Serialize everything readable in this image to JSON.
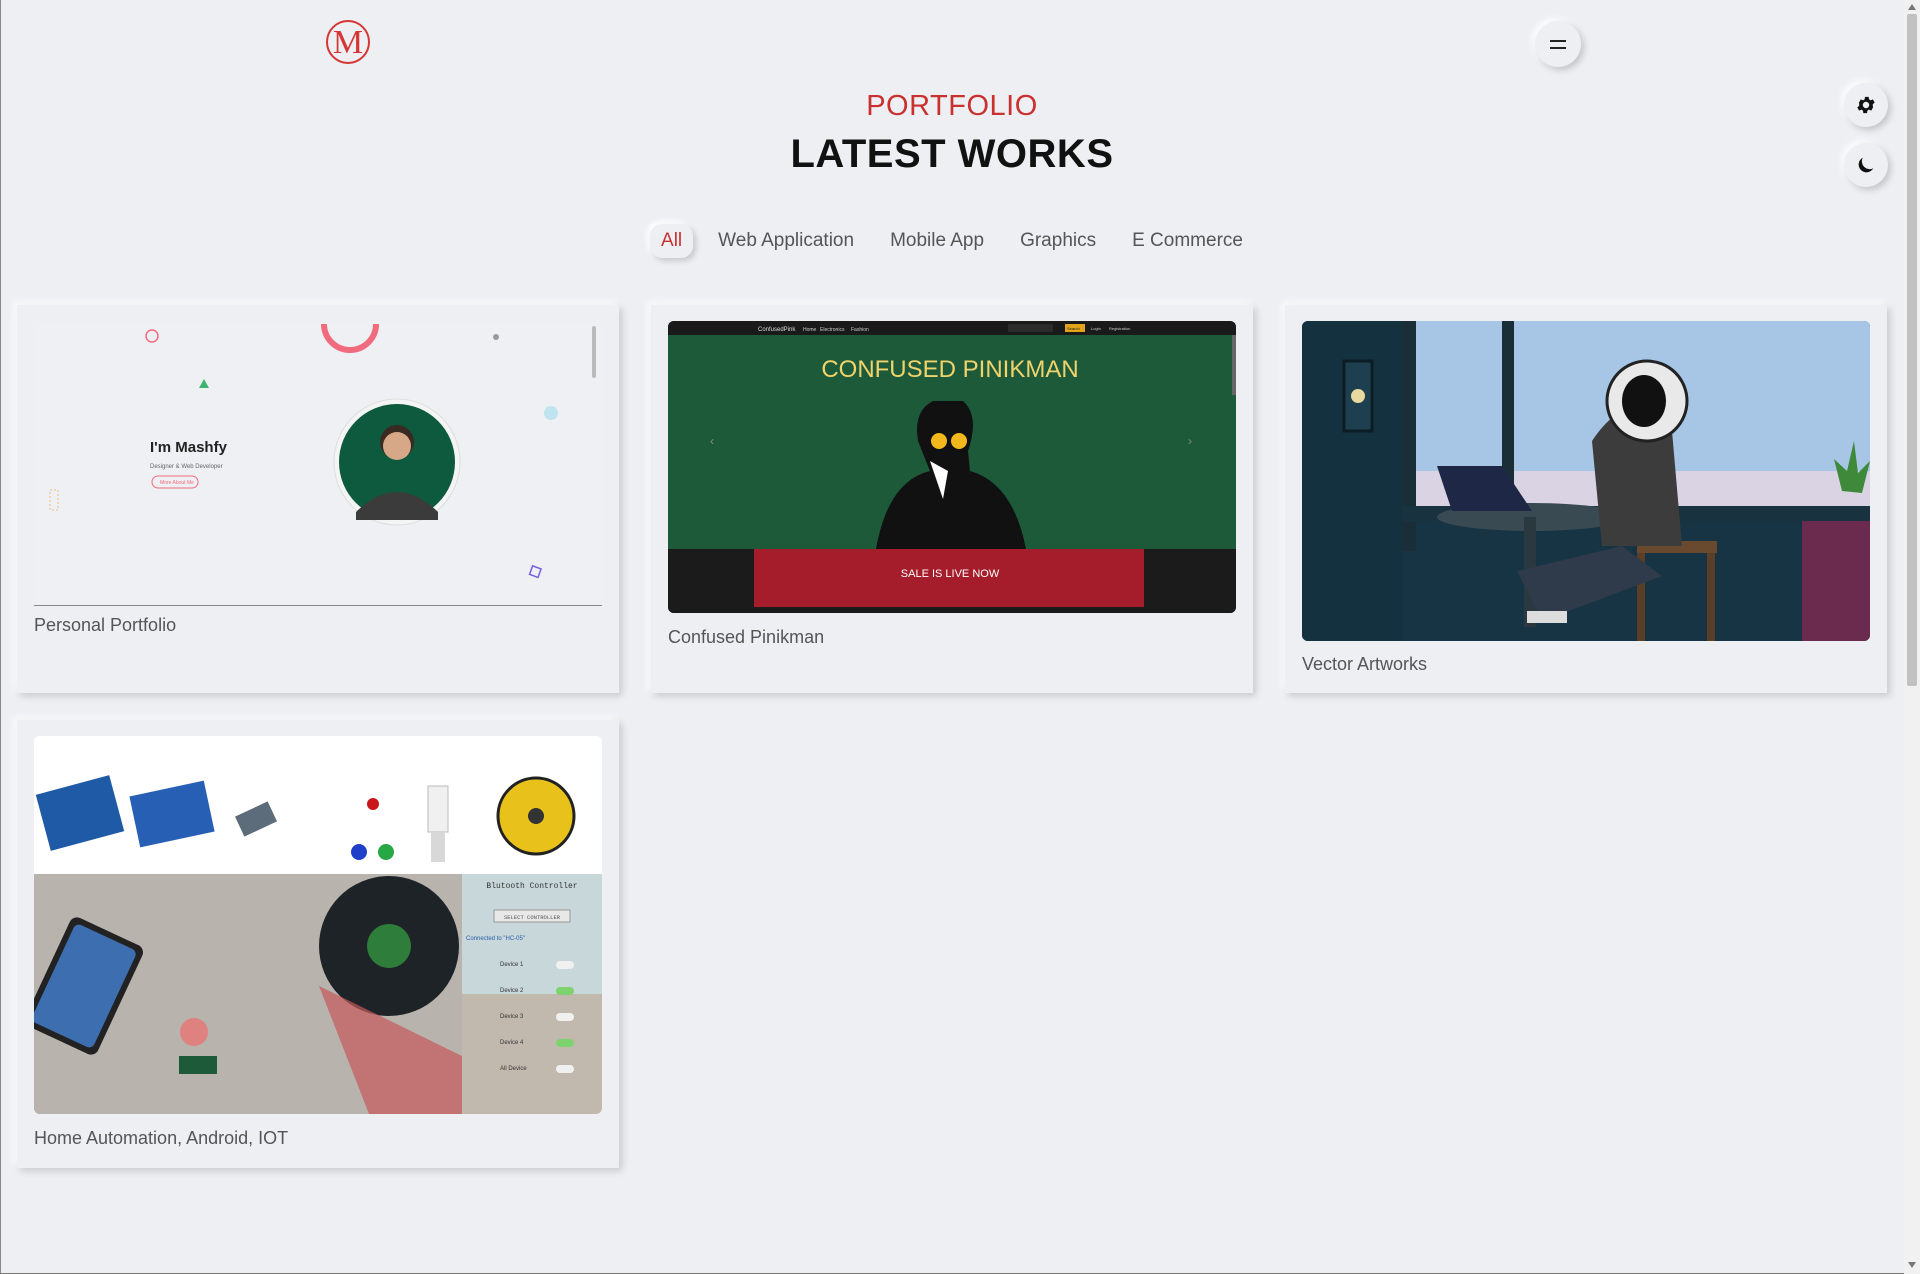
{
  "header": {
    "logo_letter": "M",
    "menu_icon": "hamburger-icon"
  },
  "side_controls": {
    "settings_icon": "gear-icon",
    "theme_icon": "moon-icon"
  },
  "section": {
    "subtitle": "PORTFOLIO",
    "title": "LATEST WORKS"
  },
  "filters": [
    {
      "label": "All",
      "active": true
    },
    {
      "label": "Web Application",
      "active": false
    },
    {
      "label": "Mobile App",
      "active": false
    },
    {
      "label": "Graphics",
      "active": false
    },
    {
      "label": "E Commerce",
      "active": false
    }
  ],
  "projects": [
    {
      "title": "Personal Portfolio",
      "preview": {
        "name": "I'm Mashfy",
        "role": "Designer & Web Developer",
        "cta": "More About Me"
      }
    },
    {
      "title": "Confused Pinikman",
      "preview": {
        "brand": "ConfusedPink",
        "nav": [
          "Home",
          "Electronics",
          "Fashion"
        ],
        "buttons": [
          "Search",
          "Login",
          "Registration"
        ],
        "hero": "CONFUSED PINIKMAN",
        "banner": "SALE IS LIVE NOW"
      }
    },
    {
      "title": "Vector Artworks"
    },
    {
      "title": "Home Automation, Android, IOT",
      "preview": {
        "app_title": "Blutooth Controller",
        "select_button": "SELECT CONTROLLER",
        "connection": "Connected to \"HC-05\"",
        "devices": [
          "Device 1",
          "Device 2",
          "Device 3",
          "Device 4",
          "All Device"
        ]
      }
    }
  ],
  "colors": {
    "accent": "#c9312f",
    "background": "#eeeff3"
  }
}
